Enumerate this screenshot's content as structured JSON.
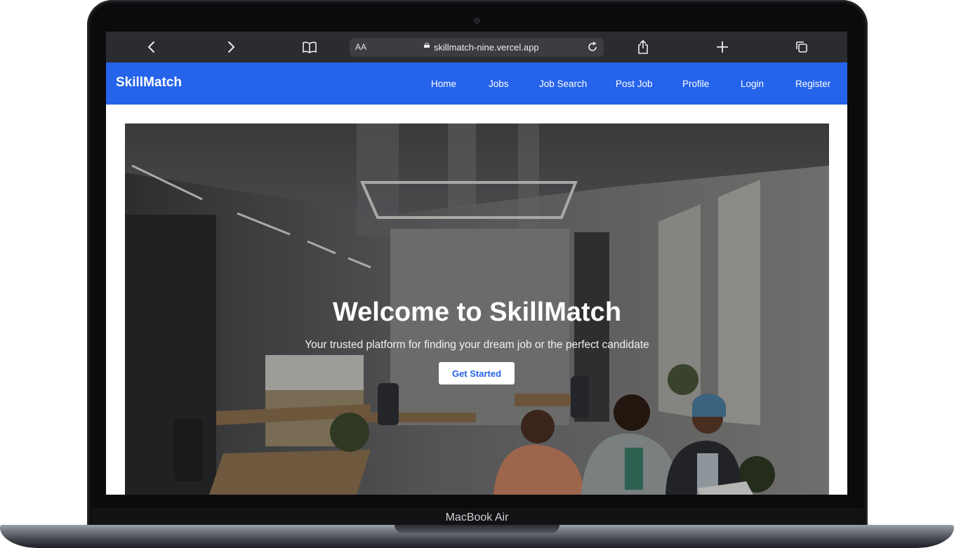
{
  "device": {
    "model_label": "MacBook Air"
  },
  "browser": {
    "text_size_label": "AA",
    "url": "skillmatch-nine.vercel.app",
    "icons": [
      "back-icon",
      "forward-icon",
      "bookmarks-icon",
      "lock-icon",
      "reload-icon",
      "share-icon",
      "new-tab-icon",
      "tabs-icon"
    ]
  },
  "site": {
    "brand": "SkillMatch",
    "nav": [
      "Home",
      "Jobs",
      "Job Search",
      "Post Job",
      "Profile",
      "Login",
      "Register"
    ],
    "accent_color": "#2563eb"
  },
  "hero": {
    "title": "Welcome to SkillMatch",
    "subtitle": "Your trusted platform for finding your dream job or the perfect candidate",
    "cta_label": "Get Started"
  }
}
